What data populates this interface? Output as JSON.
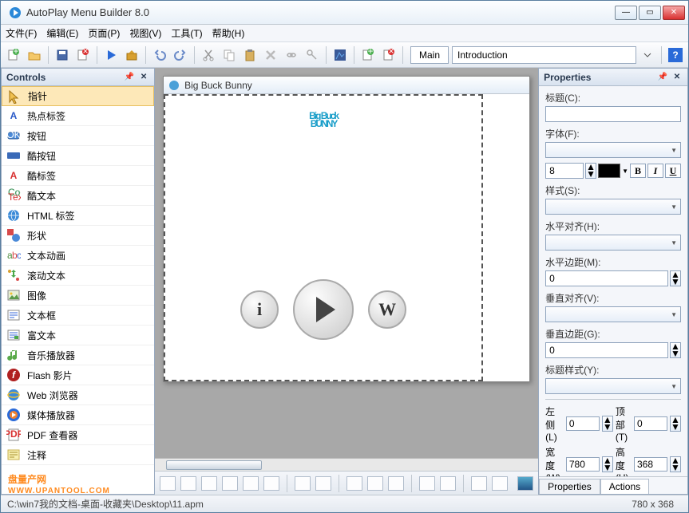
{
  "window": {
    "title": "AutoPlay Menu Builder 8.0"
  },
  "menus": [
    "文件(F)",
    "编辑(E)",
    "页面(P)",
    "视图(V)",
    "工具(T)",
    "帮助(H)"
  ],
  "tabs": {
    "main": "Main",
    "intro": "Introduction"
  },
  "controls_panel": {
    "title": "Controls"
  },
  "controls": [
    {
      "id": "pointer",
      "label": "指针"
    },
    {
      "id": "hotlabel",
      "label": "热点标签"
    },
    {
      "id": "button",
      "label": "按钮"
    },
    {
      "id": "coolbutton",
      "label": "酷按钮"
    },
    {
      "id": "coollabel",
      "label": "酷标签"
    },
    {
      "id": "cooltext",
      "label": "酷文本"
    },
    {
      "id": "htmllabel",
      "label": "HTML 标签"
    },
    {
      "id": "shape",
      "label": "形状"
    },
    {
      "id": "textanim",
      "label": "文本动画"
    },
    {
      "id": "scrolltext",
      "label": "滚动文本"
    },
    {
      "id": "image",
      "label": "图像"
    },
    {
      "id": "textbox",
      "label": "文本框"
    },
    {
      "id": "richtext",
      "label": "富文本"
    },
    {
      "id": "musicplayer",
      "label": "音乐播放器"
    },
    {
      "id": "flash",
      "label": "Flash 影片"
    },
    {
      "id": "webbrowser",
      "label": "Web 浏览器"
    },
    {
      "id": "mediaplayer",
      "label": "媒体播放器"
    },
    {
      "id": "pdfviewer",
      "label": "PDF 查看器"
    },
    {
      "id": "comment",
      "label": "注释"
    }
  ],
  "stage": {
    "title": "Big Buck Bunny",
    "logo1": "Big Buck",
    "logo2": "BUNNY",
    "i": "i",
    "w": "W"
  },
  "properties_panel": {
    "title": "Properties"
  },
  "props": {
    "caption_label": "标题(C):",
    "caption_value": "",
    "font_label": "字体(F):",
    "font_value": "",
    "fontsize": "8",
    "style_label": "样式(S):",
    "halign_label": "水平对齐(H):",
    "hmargin_label": "水平边距(M):",
    "hmargin_value": "0",
    "valign_label": "垂直对齐(V):",
    "vmargin_label": "垂直边距(G):",
    "vmargin_value": "0",
    "caption_style_label": "标题样式(Y):",
    "left_label": "左侧(L)",
    "left_value": "0",
    "top_label": "顶部(T)",
    "top_value": "0",
    "width_label": "宽度(W)",
    "width_value": "780",
    "height_label": "高度(H)",
    "height_value": "368",
    "tab_props": "Properties",
    "tab_actions": "Actions",
    "b": "B",
    "i": "I",
    "u": "U"
  },
  "status": {
    "path": "C:\\win7我的文档-桌面-收藏夹\\Desktop\\11.apm",
    "dims": "780 x 368"
  },
  "watermark": {
    "t1": "盘量产网",
    "t2": "WWW.UPANTOOL.COM"
  }
}
